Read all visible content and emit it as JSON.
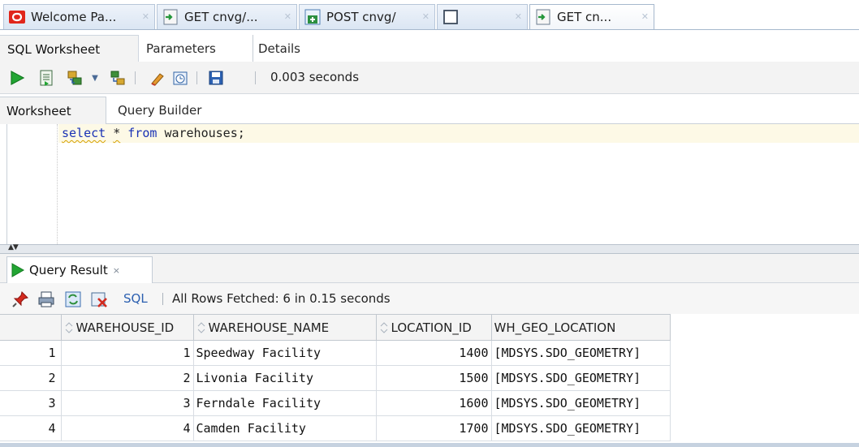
{
  "doc_tabs": [
    {
      "label": "Welcome Pa...",
      "icon": "oracle-logo-icon",
      "active": false
    },
    {
      "label": "GET cnvg/...",
      "icon": "rest-get-icon",
      "active": false
    },
    {
      "label": "POST cnvg/",
      "icon": "rest-post-icon",
      "active": false
    },
    {
      "label": "",
      "icon": "blank-document-icon",
      "active": false
    },
    {
      "label": "GET cn...",
      "icon": "rest-get-icon",
      "active": true
    }
  ],
  "sub_tabs": {
    "sql_worksheet": "SQL Worksheet",
    "parameters": "Parameters",
    "details": "Details"
  },
  "toolbar": {
    "timing": "0.003 seconds",
    "icons": [
      "run-statement-icon",
      "run-script-icon",
      "explain-plan-icon",
      "dropdown-arrow-icon",
      "autotrace-icon",
      "clear-icon",
      "history-icon",
      "save-icon"
    ]
  },
  "worksheet_tabs": {
    "worksheet": "Worksheet",
    "query_builder": "Query Builder"
  },
  "editor": {
    "line1": {
      "kw1": "select",
      "star": "*",
      "kw2": "from",
      "rest": "warehouses;"
    }
  },
  "result": {
    "tab_label": "Query Result",
    "close": "×",
    "sql_link": "SQL",
    "status": "All Rows Fetched: 6 in 0.15 seconds",
    "columns": [
      "WAREHOUSE_ID",
      "WAREHOUSE_NAME",
      "LOCATION_ID",
      "WH_GEO_LOCATION"
    ],
    "rows": [
      {
        "n": "1",
        "id": "1",
        "name": "Speedway Facility",
        "loc": "1400",
        "geo": "[MDSYS.SDO_GEOMETRY]"
      },
      {
        "n": "2",
        "id": "2",
        "name": "Livonia Facility",
        "loc": "1500",
        "geo": "[MDSYS.SDO_GEOMETRY]"
      },
      {
        "n": "3",
        "id": "3",
        "name": "Ferndale Facility",
        "loc": "1600",
        "geo": "[MDSYS.SDO_GEOMETRY]"
      },
      {
        "n": "4",
        "id": "4",
        "name": "Camden Facility",
        "loc": "1700",
        "geo": "[MDSYS.SDO_GEOMETRY]"
      }
    ]
  },
  "colors": {
    "accent_blue": "#2b5fb0",
    "run_green": "#1e9a2c",
    "keyword_blue": "#1a32b5",
    "current_line": "#fdf9e6"
  }
}
